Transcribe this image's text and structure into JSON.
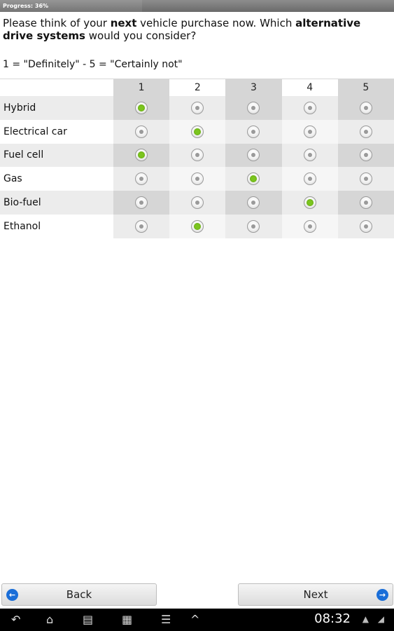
{
  "progress": {
    "label": "Progress: 36%",
    "value_percent": 36
  },
  "question": {
    "part1": "Please think of your ",
    "bold1": "next",
    "part2": " vehicle purchase now. Which ",
    "bold2": "alternative drive systems",
    "part3": " would you consider?"
  },
  "scale_note": "1 = \"Definitely\" - 5 = \"Certainly not\"",
  "grid": {
    "columns": [
      "1",
      "2",
      "3",
      "4",
      "5"
    ],
    "rows": [
      {
        "label": "Hybrid",
        "selected": 1
      },
      {
        "label": "Electrical car",
        "selected": 2
      },
      {
        "label": "Fuel cell",
        "selected": 1
      },
      {
        "label": "Gas",
        "selected": 3
      },
      {
        "label": "Bio-fuel",
        "selected": 4
      },
      {
        "label": "Ethanol",
        "selected": 2
      }
    ]
  },
  "nav": {
    "back_label": "Back",
    "next_label": "Next"
  },
  "system_bar": {
    "time": "08:32"
  },
  "colors": {
    "accent_selected": "#7cc51f",
    "nav_icon": "#1a6ed8"
  },
  "icons": {
    "back": "arrow-left-icon",
    "home": "home-icon",
    "recents": "recent-apps-icon",
    "screenshot": "screenshot-icon",
    "menu": "menu-icon",
    "up": "chevron-up-icon",
    "wifi": "wifi-icon",
    "signal": "signal-icon"
  }
}
